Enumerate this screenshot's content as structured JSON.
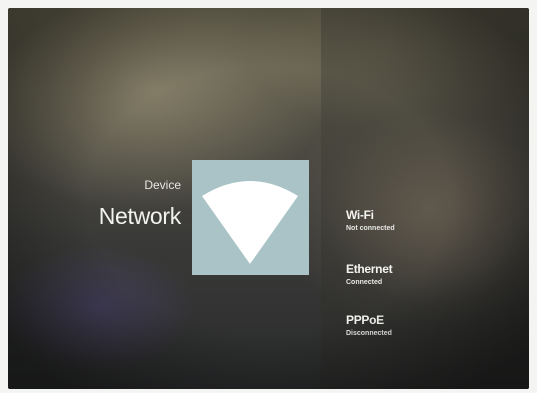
{
  "category": {
    "label": "Device",
    "title": "Network"
  },
  "tile": {
    "icon": "wifi-signal-icon",
    "background": "#a9c3c6",
    "icon_color": "#ffffff"
  },
  "menu": {
    "items": [
      {
        "title": "Wi-Fi",
        "status": "Not connected"
      },
      {
        "title": "Ethernet",
        "status": "Connected"
      },
      {
        "title": "PPPoE",
        "status": "Disconnected"
      }
    ]
  }
}
